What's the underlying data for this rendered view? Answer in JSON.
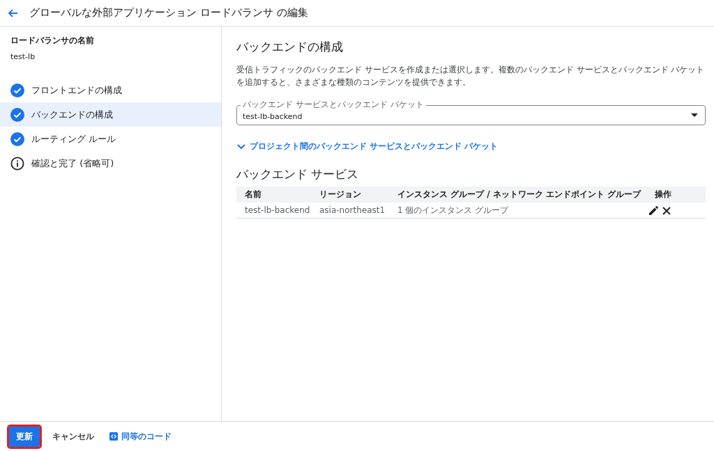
{
  "header": {
    "title": "グローバルな外部アプリケーション ロードバランサ の編集"
  },
  "sidebar": {
    "name_label": "ロードバランサの名前",
    "name_value": "test-lb",
    "steps": [
      {
        "label": "フロントエンドの構成",
        "kind": "done",
        "selected": false
      },
      {
        "label": "バックエンドの構成",
        "kind": "done",
        "selected": true
      },
      {
        "label": "ルーティング ルール",
        "kind": "done",
        "selected": false
      },
      {
        "label": "確認と完了 (省略可)",
        "kind": "info",
        "selected": false
      }
    ]
  },
  "main": {
    "heading": "バックエンドの構成",
    "description": "受信トラフィックのバックエンド サービスを作成または選択します。複数のバックエンド サービスとバックエンド バケットを追加すると、さまざまな種類のコンテンツを提供できます。",
    "select": {
      "label": "バックエンド サービスとバックエンド バケット",
      "value": "test-lb-backend"
    },
    "expander": {
      "label": "プロジェクト間のバックエンド サービスとバックエンド バケット",
      "expanded": false
    },
    "services_heading": "バックエンド サービス",
    "table": {
      "columns": [
        "名前",
        "リージョン",
        "インスタンス グループ / ネットワーク エンドポイント グループ",
        "操作"
      ],
      "rows": [
        {
          "cells": [
            "test-lb-backend",
            "asia-northeast1",
            "1 個のインスタンス グループ"
          ]
        }
      ]
    }
  },
  "footer": {
    "buttons": [
      {
        "label": "更新",
        "kind": "primary",
        "highlighted": true
      },
      {
        "label": "キャンセル",
        "kind": "text",
        "highlighted": false
      },
      {
        "label": "同等のコード",
        "kind": "code",
        "highlighted": false
      }
    ]
  }
}
